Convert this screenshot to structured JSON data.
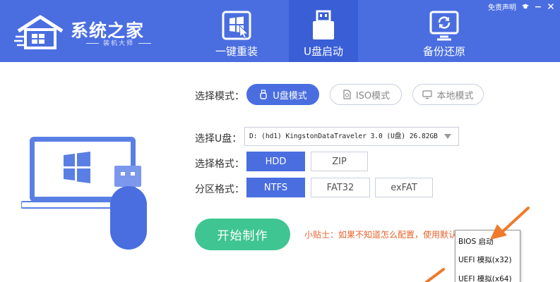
{
  "app": {
    "title": "系统之家",
    "subtitle": "装机大师"
  },
  "top_links": {
    "disclaimer": "免责声明",
    "icons": [
      "graduation-cap-icon",
      "minimize-icon",
      "close-icon"
    ]
  },
  "nav": {
    "tabs": [
      {
        "label": "一键重装",
        "icon": "windows-cursor-icon",
        "active": false
      },
      {
        "label": "U盘启动",
        "icon": "usb-drive-icon",
        "active": true
      },
      {
        "label": "备份还原",
        "icon": "backup-restore-icon",
        "active": false
      }
    ]
  },
  "form": {
    "mode_label": "选择模式：",
    "modes": [
      {
        "label": "U盘模式",
        "icon": "usb-icon",
        "active": true
      },
      {
        "label": "ISO模式",
        "icon": "iso-file-icon",
        "active": false
      },
      {
        "label": "本地模式",
        "icon": "monitor-icon",
        "active": false
      }
    ],
    "usb_label": "选择U盘：",
    "usb_value": "D: (hd1) KingstonDataTraveler 3.0 (U盘) 26.82GB",
    "format_label": "选择格式：",
    "formats": [
      {
        "label": "HDD",
        "active": true
      },
      {
        "label": "ZIP",
        "active": false
      }
    ],
    "partition_label": "分区格式：",
    "partitions": [
      {
        "label": "NTFS",
        "active": true
      },
      {
        "label": "FAT32",
        "active": false
      },
      {
        "label": "exFAT",
        "active": false
      }
    ],
    "start_button": "开始制作",
    "tip": "小贴士：如果不知道怎么配置，使用默认配置"
  },
  "context_menu": {
    "items": [
      "BIOS 启动",
      "UEFI 模拟(x32)",
      "UEFI 模拟(x64)"
    ]
  },
  "colors": {
    "header": "#4a6ee0",
    "active_tab": "#3a5ed5",
    "start_button": "#3fc592",
    "tip": "#e8622c",
    "arrow": "#f07a2a"
  }
}
